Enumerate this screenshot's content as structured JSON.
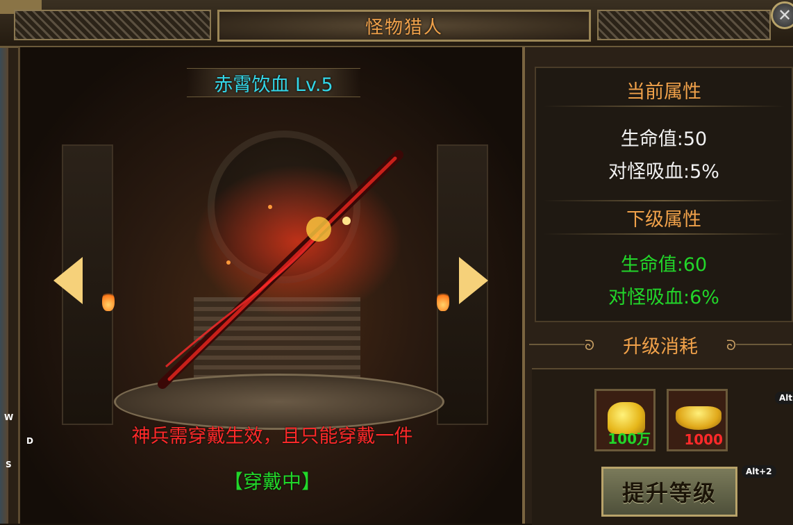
{
  "window": {
    "title": "怪物猎人",
    "close_icon": "close-x-icon"
  },
  "weapon": {
    "name": "赤霄饮血 Lv.5"
  },
  "stage": {
    "notice": "神兵需穿戴生效，且只能穿戴一件",
    "status": "【穿戴中】"
  },
  "current_attributes": {
    "title": "当前属性",
    "items": [
      "生命值:50",
      "对怪吸血:5%"
    ]
  },
  "next_attributes": {
    "title": "下级属性",
    "items": [
      "生命值:60",
      "对怪吸血:6%"
    ]
  },
  "cost": {
    "title": "升级消耗",
    "items": [
      {
        "icon": "gold-coin-pile-icon",
        "amount": "100万",
        "color": "#22d62a"
      },
      {
        "icon": "gold-ingot-icon",
        "amount": "1000",
        "color": "#ff2a2a"
      }
    ]
  },
  "upgrade_button": "提升等级",
  "hints": {
    "alt": "Alt",
    "alt2": "Alt+2",
    "w": "W",
    "d": "D",
    "s": "S"
  },
  "colors": {
    "title": "#f0a14a",
    "weapon_name": "#33d6e8",
    "notice": "#ff2a2a",
    "positive": "#22d62a"
  }
}
